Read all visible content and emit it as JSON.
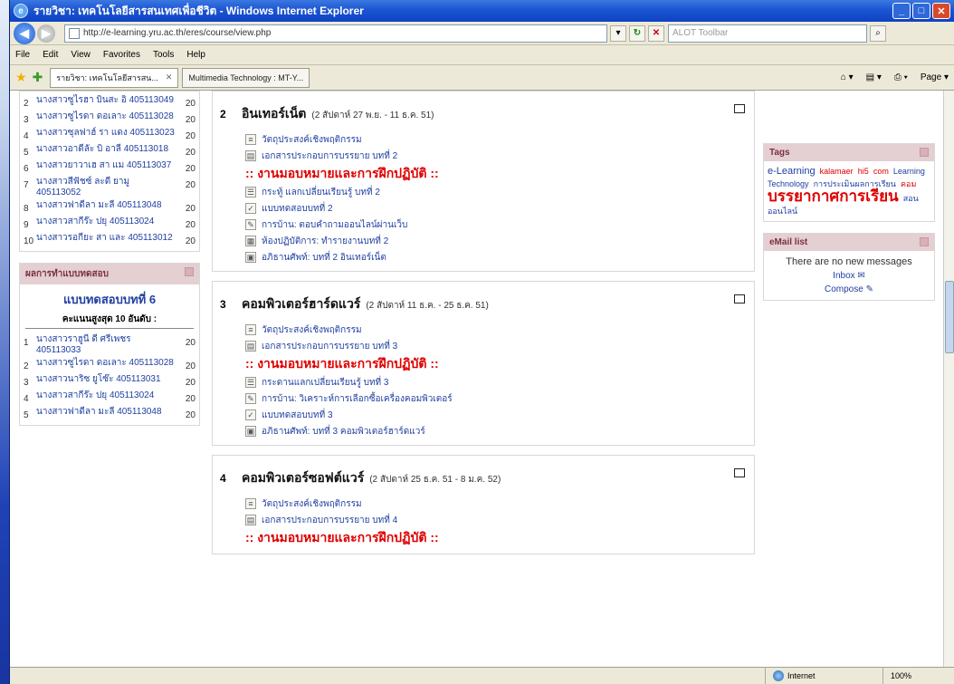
{
  "window": {
    "title": "รายวิชา: เทคโนโลยีสารสนเทศเพื่อชีวิต - Windows Internet Explorer"
  },
  "addressbar": {
    "url": "http://e-learning.yru.ac.th/eres/course/view.php",
    "search_placeholder": "ALOT Toolbar"
  },
  "menu": [
    "File",
    "Edit",
    "View",
    "Favorites",
    "Tools",
    "Help"
  ],
  "tabs": [
    "รายวิชา: เทคโนโลยีสารสน...",
    "Multimedia Technology : MT-Y..."
  ],
  "toolbar": {
    "page_label": "Page"
  },
  "left": {
    "rank_list_top": [
      {
        "n": "2",
        "name": "นางสาวซูไรฮา บินสะ อิ 405113049",
        "score": "20"
      },
      {
        "n": "3",
        "name": "นางสาวซูไรดา ดอเลาะ 405113028",
        "score": "20"
      },
      {
        "n": "4",
        "name": "นางสาวซุลฟาฮ์ รา แดง 405113023",
        "score": "20"
      },
      {
        "n": "5",
        "name": "นางสาวอาดีลัะ บิ อาลี 405113018",
        "score": "20"
      },
      {
        "n": "6",
        "name": "นางสาวยาวาเฮ สา แม 405113037",
        "score": "20"
      },
      {
        "n": "7",
        "name": "นางสาวสีฟัชซ์ ละดี ยามู 405113052",
        "score": "20"
      },
      {
        "n": "8",
        "name": "นางสาวฟาดีลา มะลี 405113048",
        "score": "20"
      },
      {
        "n": "9",
        "name": "นางสาวสากีร๊ะ ปยุ 405113024",
        "score": "20"
      },
      {
        "n": "10",
        "name": "นางสาวรอกียะ สา และ 405113012",
        "score": "20"
      }
    ],
    "quiz_block_title": "ผลการทำแบบทดสอบ",
    "quiz_name": "แบบทดสอบบทที่ 6",
    "quiz_sub": "คะแนนสูงสุด 10 อันดับ :",
    "rank_list_quiz": [
      {
        "n": "1",
        "name": "นางสาวราฮูนี ดี ศรีเพชร 405113033",
        "score": "20"
      },
      {
        "n": "2",
        "name": "นางสาวซูไรดา ดอเลาะ 405113028",
        "score": "20"
      },
      {
        "n": "3",
        "name": "นางสาวนาริซ ยูโซ๊ะ 405113031",
        "score": "20"
      },
      {
        "n": "4",
        "name": "นางสาวสากีร๊ะ ปยุ 405113024",
        "score": "20"
      },
      {
        "n": "5",
        "name": "นางสาวฟาดีลา มะลี 405113048",
        "score": "20"
      }
    ]
  },
  "topics": [
    {
      "num": "2",
      "title": "อินเทอร์เน็ต",
      "date": "(2 สัปดาห์ 27 พ.ย. - 11 ธ.ค. 51)",
      "acts": [
        {
          "kind": "doc",
          "text": "วัตถุประสงค์เชิงพฤติกรรม"
        },
        {
          "kind": "pdf",
          "text": "เอกสารประกอบการบรรยาย บทที่ 2"
        },
        {
          "kind": "label",
          "text": ":: งานมอบหมายและการฝึกปฏิบัติ ::"
        },
        {
          "kind": "forum",
          "text": "กระทู้ แลกเปลี่ยนเรียนรู้ บทที่ 2"
        },
        {
          "kind": "quiz",
          "text": "แบบทดสอบบทที่ 2"
        },
        {
          "kind": "assign",
          "text": "การบ้าน: ตอบคำถามออนไลน์ผ่านเว็บ"
        },
        {
          "kind": "lab",
          "text": "ห้องปฏิบัติการ: ทำรายงานบทที่ 2"
        },
        {
          "kind": "gloss",
          "text": "อภิธานศัพท์: บทที่ 2 อินเทอร์เน็ต"
        }
      ]
    },
    {
      "num": "3",
      "title": "คอมพิวเตอร์ฮาร์ดแวร์",
      "date": "(2 สัปดาห์ 11 ธ.ค. - 25 ธ.ค. 51)",
      "acts": [
        {
          "kind": "doc",
          "text": "วัตถุประสงค์เชิงพฤติกรรม"
        },
        {
          "kind": "pdf",
          "text": "เอกสารประกอบการบรรยาย บทที่ 3"
        },
        {
          "kind": "label",
          "text": ":: งานมอบหมายและการฝึกปฏิบัติ ::"
        },
        {
          "kind": "forum",
          "text": "กระดานแลกเปลี่ยนเรียนรู้ บทที่ 3"
        },
        {
          "kind": "assign",
          "text": "การบ้าน: วิเคราะห์การเลือกซื้อเครื่องคอมพิวเตอร์"
        },
        {
          "kind": "quiz",
          "text": "แบบทดสอบบทที่ 3"
        },
        {
          "kind": "gloss",
          "text": "อภิธานศัพท์: บทที่ 3 คอมพิวเตอร์ฮาร์ดแวร์"
        }
      ]
    },
    {
      "num": "4",
      "title": "คอมพิวเตอร์ซอฟต์แวร์",
      "date": "(2 สัปดาห์ 25 ธ.ค. 51 - 8 ม.ค. 52)",
      "acts": [
        {
          "kind": "doc",
          "text": "วัตถุประสงค์เชิงพฤติกรรม"
        },
        {
          "kind": "pdf",
          "text": "เอกสารประกอบการบรรยาย บทที่ 4"
        },
        {
          "kind": "label",
          "text": ":: งานมอบหมายและการฝึกปฏิบัติ ::"
        }
      ]
    }
  ],
  "right": {
    "tags_title": "Tags",
    "tags": [
      {
        "t": "e-Learning",
        "s": "m"
      },
      {
        "t": "kalamaer",
        "s": "r"
      },
      {
        "t": "hi5",
        "s": "r"
      },
      {
        "t": "com",
        "s": "r"
      },
      {
        "t": "Learning",
        "s": "s"
      },
      {
        "t": "Technology",
        "s": "s"
      },
      {
        "t": "การประเมินผลการเรียน",
        "s": "s"
      },
      {
        "t": "คอม",
        "s": "r"
      },
      {
        "t": "บรรยากาศการเรียน",
        "s": "big"
      },
      {
        "t": "สอนออนไลน์",
        "s": "s"
      }
    ],
    "mail_title": "eMail list",
    "mail_msg": "There are no new messages",
    "inbox": "Inbox",
    "compose": "Compose"
  },
  "status": {
    "zone": "Internet",
    "zoom": "100%"
  }
}
